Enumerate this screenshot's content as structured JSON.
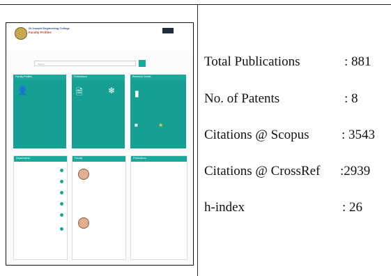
{
  "screenshot": {
    "institution": "St Joseph Engineering College",
    "portal_title": "Faculty Profiles",
    "search_placeholder": "Search",
    "cards": [
      {
        "title": "Faculty Profiles"
      },
      {
        "title": "Publications"
      },
      {
        "title": "Research Grants"
      }
    ],
    "lists": [
      {
        "title": "Departments"
      },
      {
        "title": "Faculty"
      },
      {
        "title": "Publications"
      }
    ]
  },
  "stats": [
    {
      "label": "Total Publications",
      "value": ": 881"
    },
    {
      "label": "No. of Patents",
      "value": ": 8"
    },
    {
      "label": "Citations @ Scopus",
      "value": ": 3543"
    },
    {
      "label": "Citations @ CrossRef",
      "value": ":2939"
    },
    {
      "label": "h-index",
      "value": ": 26"
    }
  ],
  "colors": {
    "accent": "#1aa89a",
    "ink": "#111111"
  }
}
